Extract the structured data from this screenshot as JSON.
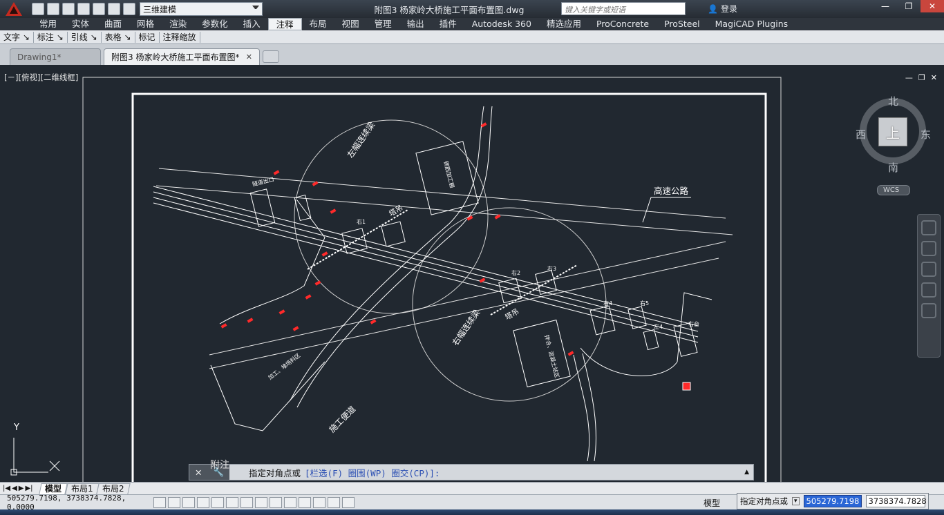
{
  "titlebar": {
    "workspace": "三维建模",
    "document_title": "附图3 杨家岭大桥施工平面布置图.dwg",
    "search_placeholder": "键入关键字或短语",
    "login_label": "登录"
  },
  "ribbon": {
    "tabs": [
      "常用",
      "实体",
      "曲面",
      "网格",
      "渲染",
      "参数化",
      "插入",
      "注释",
      "布局",
      "视图",
      "管理",
      "输出",
      "插件",
      "Autodesk 360",
      "精选应用",
      "ProConcrete",
      "ProSteel",
      "MagiCAD Plugins"
    ],
    "active_tab": "注释",
    "panels": [
      "文字 ↘",
      "标注 ↘",
      "引线 ↘",
      "表格 ↘",
      "标记",
      "注释缩放"
    ]
  },
  "file_tabs": {
    "inactive": "Drawing1*",
    "active": "附图3 杨家岭大桥施工平面布置图*"
  },
  "viewport": {
    "label": "[－][俯视][二维线框]",
    "viewcube": {
      "top": "上",
      "north": "北",
      "south": "南",
      "east": "东",
      "west": "西",
      "wcs": "WCS"
    }
  },
  "drawing_labels": {
    "left_beam_field": "左幅连续梁",
    "right_beam_field": "右幅连续梁",
    "highway": "高速公路",
    "tower_crane_1": "塔吊",
    "tower_crane_2": "塔吊",
    "construction_road": "施工便道",
    "processing_area": "加工、堆场料区",
    "office_area_1": "钢筋加工棚",
    "office_area_2": "拌合、混凝土站区",
    "pier_1": "右1",
    "pier_2": "右2",
    "pier_3": "右3",
    "pier_4": "右4",
    "pier_5": "右5",
    "pier_left": "左4",
    "abutment": "右台",
    "tunnel": "隧道出口",
    "note": "附注",
    "ucs_y": "Y"
  },
  "command_line": {
    "prompt": "指定对角点或",
    "options": "[栏选(F) 圈围(WP) 圈交(CP)]:",
    "overlay": "附注"
  },
  "layout_tabs": [
    "模型",
    "布局1",
    "布局2"
  ],
  "status": {
    "coords": "505279.7198, 3738374.7828, 0.0000",
    "model": "模型",
    "dynamic_prompt": "指定对角点或",
    "dyn_x": "505279.7198",
    "dyn_y": "3738374.7828"
  }
}
